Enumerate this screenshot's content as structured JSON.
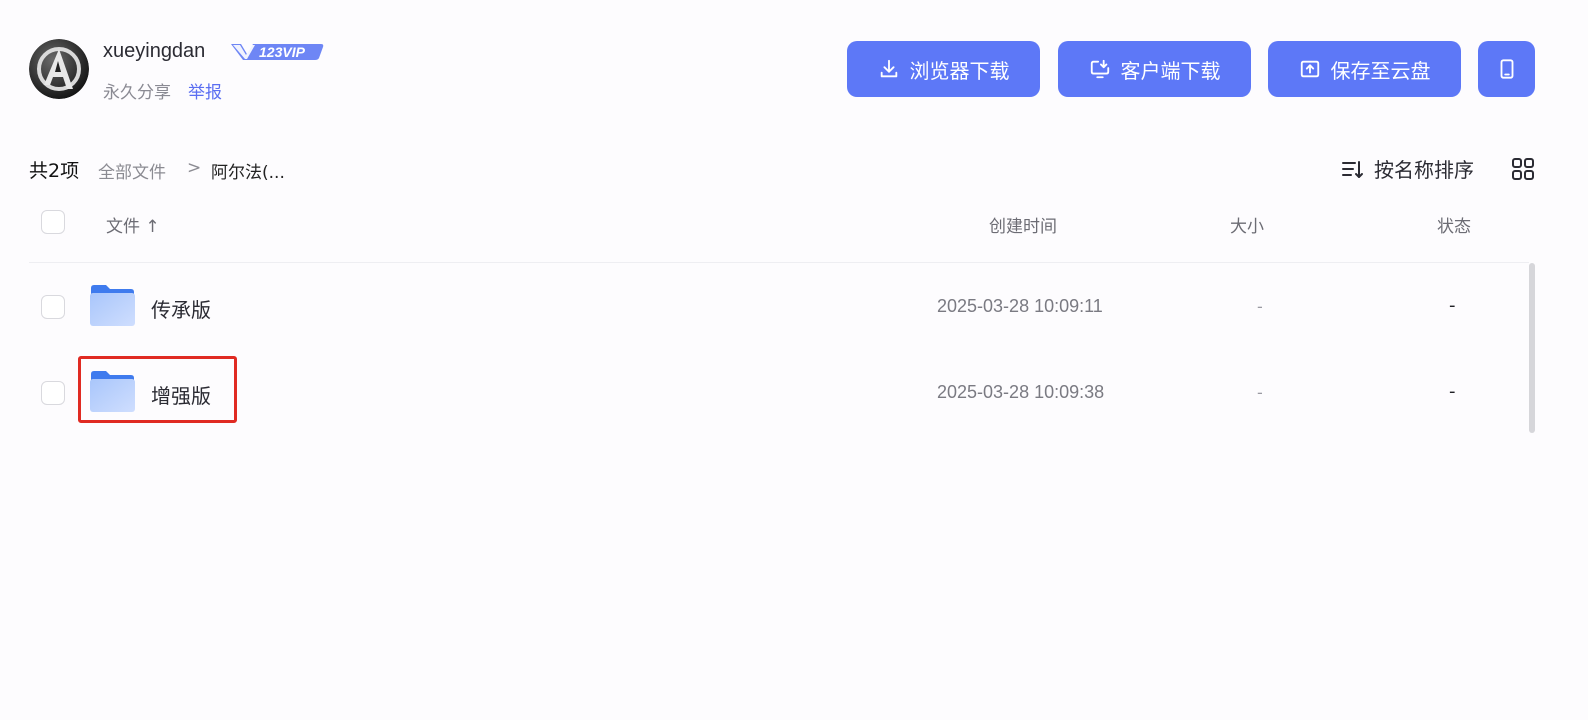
{
  "user": {
    "name": "xueyingdan",
    "vip_label": "123VIP",
    "share_type": "永久分享",
    "report_label": "举报"
  },
  "actions": {
    "browser_download": "浏览器下载",
    "client_download": "客户端下载",
    "save_to_cloud": "保存至云盘"
  },
  "breadcrumb": {
    "count": "共2项",
    "root": "全部文件",
    "separator": ">",
    "current": "阿尔法(..."
  },
  "sort_label": "按名称排序",
  "table": {
    "headers": {
      "name": "文件 ↑",
      "created": "创建时间",
      "size": "大小",
      "status": "状态"
    },
    "rows": [
      {
        "name": "传承版",
        "created": "2025-03-28 10:09:11",
        "size": "-",
        "status": "-"
      },
      {
        "name": "增强版",
        "created": "2025-03-28 10:09:38",
        "size": "-",
        "status": "-"
      }
    ]
  },
  "colors": {
    "primary": "#5d78f7",
    "highlight": "#e02a22",
    "folder": "#4a7cf0"
  }
}
